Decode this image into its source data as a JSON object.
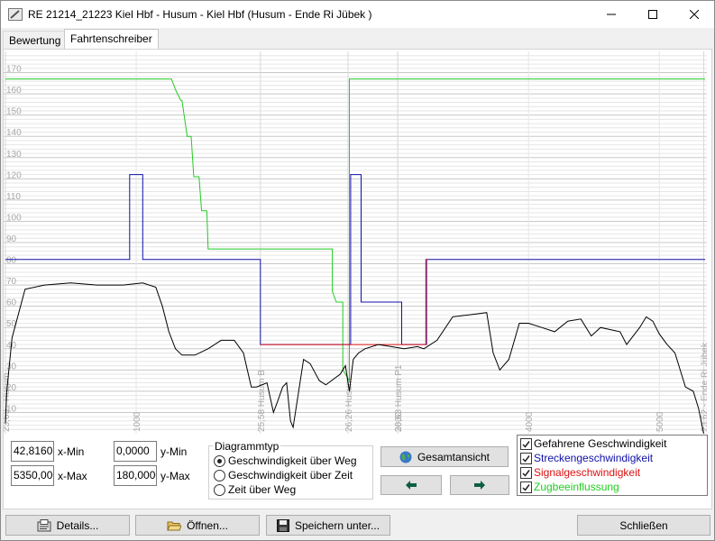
{
  "window": {
    "title": "RE 21214_21223 Kiel Hbf - Husum - Kiel Hbf (Husum - Ende Ri Jübek )"
  },
  "tabs": [
    {
      "label": "Bewertung",
      "active": false
    },
    {
      "label": "Fahrtenschreiber",
      "active": true
    }
  ],
  "chart_data": {
    "type": "line",
    "xlim": [
      0,
      5350
    ],
    "ylim": [
      0,
      180
    ],
    "y_ticks": [
      10,
      20,
      30,
      40,
      50,
      60,
      70,
      80,
      90,
      100,
      110,
      120,
      130,
      140,
      150,
      160,
      170
    ],
    "x_ticks": [
      {
        "x": 1000,
        "label": "1000"
      },
      {
        "x": 3000,
        "label": "3000"
      },
      {
        "x": 4000,
        "label": "4000"
      },
      {
        "x": 5000,
        "label": "5000"
      }
    ],
    "stations": [
      {
        "x": 0,
        "label": "23,63 - Husum"
      },
      {
        "x": 1950,
        "label": "25,58 Husum B"
      },
      {
        "x": 2620,
        "label": "26,26 Husum"
      },
      {
        "x": 3000,
        "label": "26,63 Husum P1"
      },
      {
        "x": 5340,
        "label": "23,62 - Ende Ri Jübek"
      }
    ],
    "series": [
      {
        "name": "Zugbeeinflussung",
        "color": "#22cc22",
        "points": [
          [
            0,
            167
          ],
          [
            1270,
            167
          ],
          [
            1300,
            162
          ],
          [
            1340,
            157
          ],
          [
            1350,
            157
          ],
          [
            1390,
            140
          ],
          [
            1420,
            140
          ],
          [
            1440,
            121
          ],
          [
            1480,
            121
          ],
          [
            1500,
            105
          ],
          [
            1540,
            105
          ],
          [
            1550,
            87
          ],
          [
            2500,
            87
          ],
          [
            2500,
            67
          ],
          [
            2530,
            62
          ],
          [
            2580,
            62
          ],
          [
            2580,
            30
          ],
          [
            2630,
            25
          ],
          [
            2630,
            167
          ],
          [
            5350,
            167
          ]
        ]
      },
      {
        "name": "Streckengeschwindigkeit",
        "color": "#1010aa",
        "points": [
          [
            0,
            82
          ],
          [
            950,
            82
          ],
          [
            950,
            122
          ],
          [
            1050,
            122
          ],
          [
            1050,
            82
          ],
          [
            1950,
            82
          ],
          [
            1950,
            42
          ],
          [
            2640,
            42
          ],
          [
            2640,
            122
          ],
          [
            2720,
            122
          ],
          [
            2720,
            62
          ],
          [
            3030,
            62
          ],
          [
            3030,
            42
          ],
          [
            3220,
            42
          ],
          [
            3220,
            82
          ],
          [
            5350,
            82
          ]
        ]
      },
      {
        "name": "Signalgeschwindigkeit",
        "color": "#dd1111",
        "points": [
          [
            1950,
            42
          ],
          [
            3215,
            42
          ],
          [
            3215,
            82
          ],
          [
            3225,
            82
          ]
        ]
      },
      {
        "name": "Gefahrene Geschwindigkeit",
        "color": "#000000",
        "points": [
          [
            0,
            5
          ],
          [
            10,
            20
          ],
          [
            50,
            45
          ],
          [
            150,
            68
          ],
          [
            300,
            70
          ],
          [
            500,
            71
          ],
          [
            700,
            70
          ],
          [
            900,
            70
          ],
          [
            1050,
            71
          ],
          [
            1150,
            69
          ],
          [
            1200,
            60
          ],
          [
            1250,
            48
          ],
          [
            1300,
            40
          ],
          [
            1350,
            37
          ],
          [
            1450,
            37
          ],
          [
            1550,
            40
          ],
          [
            1650,
            44
          ],
          [
            1750,
            44
          ],
          [
            1820,
            38
          ],
          [
            1880,
            22
          ],
          [
            1920,
            22
          ],
          [
            2000,
            24
          ],
          [
            2050,
            10
          ],
          [
            2080,
            15
          ],
          [
            2120,
            22
          ],
          [
            2150,
            24
          ],
          [
            2180,
            6
          ],
          [
            2200,
            3
          ],
          [
            2280,
            35
          ],
          [
            2330,
            33
          ],
          [
            2400,
            25
          ],
          [
            2450,
            23
          ],
          [
            2560,
            28
          ],
          [
            2600,
            32
          ],
          [
            2630,
            20
          ],
          [
            2660,
            35
          ],
          [
            2700,
            38
          ],
          [
            2750,
            40
          ],
          [
            2850,
            42
          ],
          [
            2950,
            41
          ],
          [
            3050,
            40
          ],
          [
            3150,
            41
          ],
          [
            3200,
            40
          ],
          [
            3300,
            44
          ],
          [
            3420,
            55
          ],
          [
            3550,
            56
          ],
          [
            3680,
            57
          ],
          [
            3730,
            38
          ],
          [
            3780,
            30
          ],
          [
            3850,
            35
          ],
          [
            3930,
            52
          ],
          [
            4000,
            52
          ],
          [
            4100,
            50
          ],
          [
            4200,
            48
          ],
          [
            4300,
            53
          ],
          [
            4400,
            54
          ],
          [
            4480,
            46
          ],
          [
            4550,
            50
          ],
          [
            4700,
            48
          ],
          [
            4750,
            42
          ],
          [
            4850,
            50
          ],
          [
            4900,
            55
          ],
          [
            4950,
            53
          ],
          [
            5000,
            47
          ],
          [
            5060,
            42
          ],
          [
            5120,
            38
          ],
          [
            5200,
            22
          ],
          [
            5260,
            20
          ],
          [
            5300,
            12
          ],
          [
            5340,
            0
          ]
        ]
      }
    ]
  },
  "controls": {
    "x_min_value": "42,8160",
    "x_min_label": "x-Min",
    "x_max_value": "5350,000",
    "x_max_label": "x-Max",
    "y_min_value": "0,0000",
    "y_min_label": "y-Min",
    "y_max_value": "180,0000",
    "y_max_label": "y-Max"
  },
  "diagram_type": {
    "title": "Diagrammtyp",
    "options": [
      {
        "label": "Geschwindigkeit über Weg",
        "selected": true
      },
      {
        "label": "Geschwindigkeit über Zeit",
        "selected": false
      },
      {
        "label": "Zeit über Weg",
        "selected": false
      }
    ]
  },
  "view_buttons": {
    "overview_label": "Gesamtansicht"
  },
  "legend": [
    {
      "label": "Gefahrene Geschwindigkeit",
      "color": "#000000",
      "checked": true
    },
    {
      "label": "Streckengeschwindigkeit",
      "color": "#1010aa",
      "checked": true
    },
    {
      "label": "Signalgeschwindigkeit",
      "color": "#dd1111",
      "checked": true
    },
    {
      "label": "Zugbeeinflussung",
      "color": "#22cc22",
      "checked": true
    }
  ],
  "footer": {
    "details_label": "Details...",
    "open_label": "Öffnen...",
    "save_label": "Speichern unter...",
    "close_label": "Schließen"
  },
  "colors": {
    "grid_major": "#c8c8c8",
    "grid_minor": "#e6e6e6",
    "tick_text": "#a8a8a8"
  }
}
